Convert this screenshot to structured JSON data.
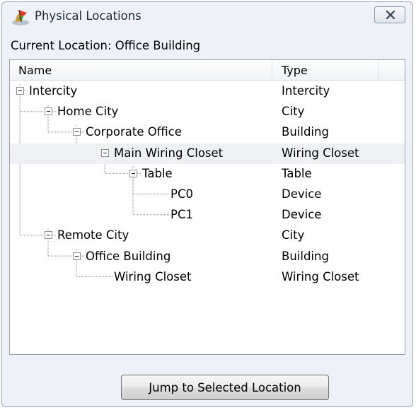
{
  "window": {
    "title": "Physical Locations",
    "app_icon": "physical-locations-icon",
    "close_icon": "close-icon"
  },
  "current_location": "Current Location: Office Building",
  "tree": {
    "columns": [
      "Name",
      "Type"
    ],
    "rows": [
      {
        "name": "Intercity",
        "type": "Intercity",
        "level": 0,
        "expandable": true,
        "selected": false
      },
      {
        "name": "Home City",
        "type": "City",
        "level": 1,
        "expandable": true,
        "selected": false
      },
      {
        "name": "Corporate Office",
        "type": "Building",
        "level": 2,
        "expandable": true,
        "selected": false
      },
      {
        "name": "Main Wiring Closet",
        "type": "Wiring Closet",
        "level": 3,
        "expandable": true,
        "selected": true
      },
      {
        "name": "Table",
        "type": "Table",
        "level": 4,
        "expandable": true,
        "selected": false
      },
      {
        "name": "PC0",
        "type": "Device",
        "level": 5,
        "expandable": false,
        "selected": false
      },
      {
        "name": "PC1",
        "type": "Device",
        "level": 5,
        "expandable": false,
        "selected": false
      },
      {
        "name": "Remote City",
        "type": "City",
        "level": 1,
        "expandable": true,
        "selected": false
      },
      {
        "name": "Office Building",
        "type": "Building",
        "level": 2,
        "expandable": true,
        "selected": false
      },
      {
        "name": "Wiring Closet",
        "type": "Wiring Closet",
        "level": 3,
        "expandable": false,
        "selected": false
      }
    ]
  },
  "buttons": {
    "jump": "Jump to Selected Location"
  }
}
